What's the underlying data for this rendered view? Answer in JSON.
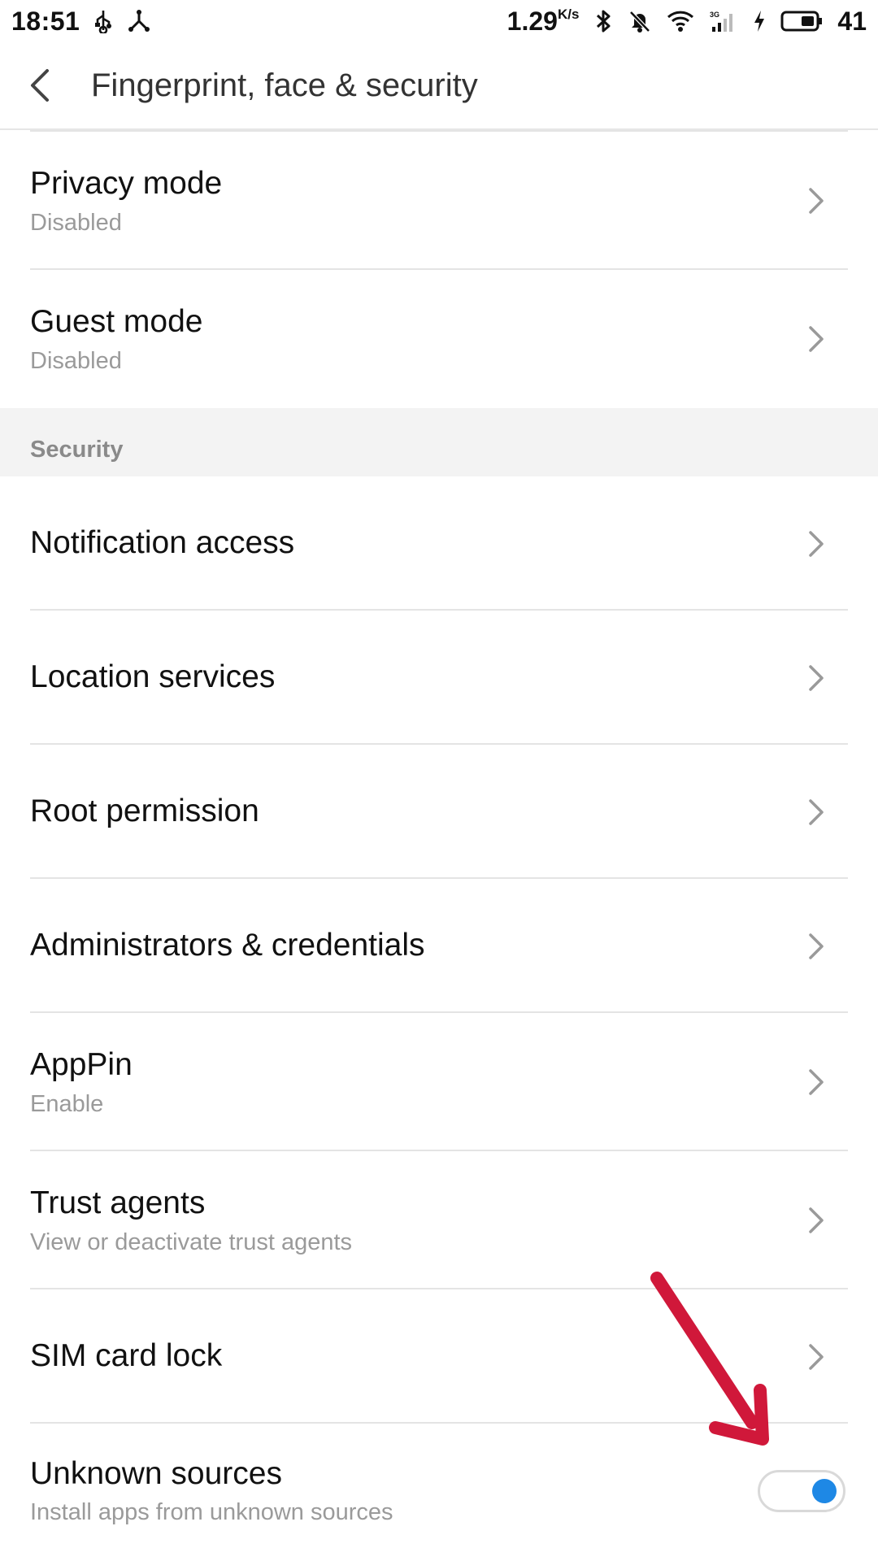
{
  "status_bar": {
    "time": "18:51",
    "speed": "1.29",
    "speed_unit": "K/s",
    "battery": "41"
  },
  "header": {
    "title": "Fingerprint, face & security"
  },
  "rows_top": [
    {
      "title": "Privacy mode",
      "subtitle": "Disabled"
    },
    {
      "title": "Guest mode",
      "subtitle": "Disabled"
    }
  ],
  "section": {
    "label": "Security"
  },
  "rows_security": [
    {
      "title": "Notification access"
    },
    {
      "title": "Location services"
    },
    {
      "title": "Root permission"
    },
    {
      "title": "Administrators & credentials"
    },
    {
      "title": "AppPin",
      "subtitle": "Enable"
    },
    {
      "title": "Trust agents",
      "subtitle": "View or deactivate trust agents"
    },
    {
      "title": "SIM card lock"
    },
    {
      "title": "Unknown sources",
      "subtitle": "Install apps from unknown sources",
      "toggle_on": true
    }
  ],
  "colors": {
    "toggle_accent": "#1e88e5",
    "annotation_arrow": "#d0183a"
  },
  "icons": {
    "back": "back-arrow-icon",
    "chevron": "chevron-right-icon"
  }
}
